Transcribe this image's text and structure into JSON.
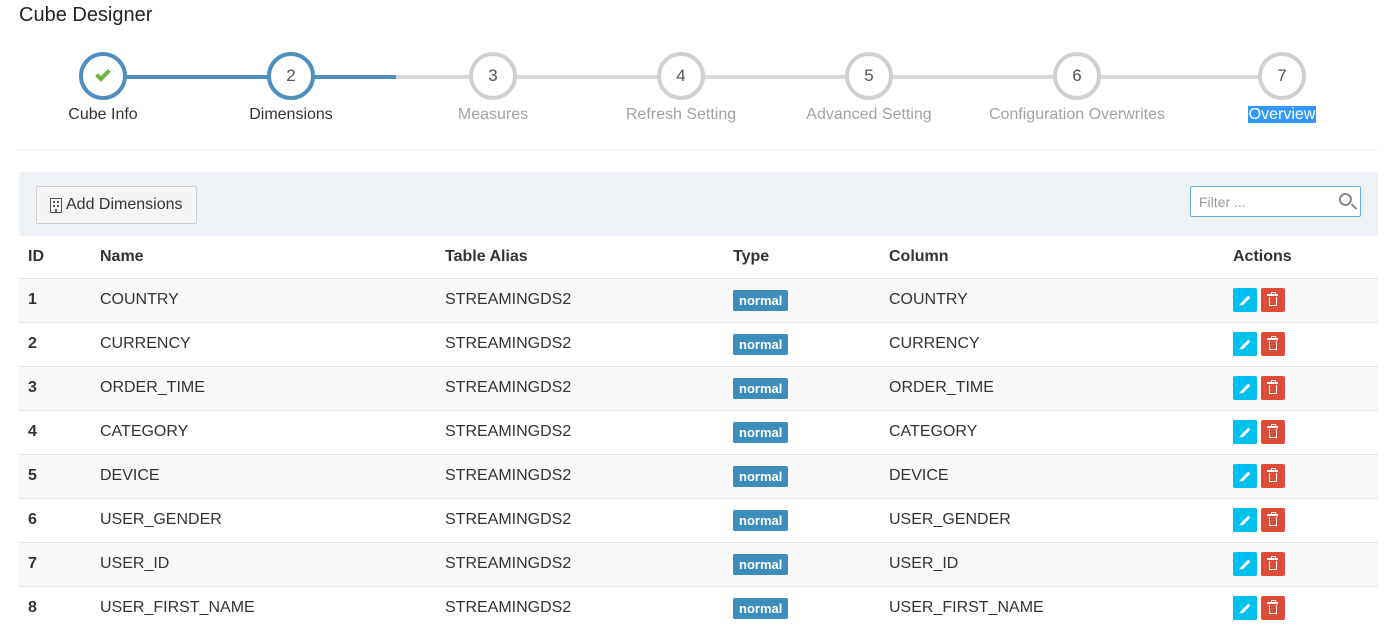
{
  "page": {
    "title": "Cube Designer"
  },
  "wizard": {
    "steps": [
      {
        "number": "1",
        "label": "Cube Info",
        "state": "complete"
      },
      {
        "number": "2",
        "label": "Dimensions",
        "state": "active"
      },
      {
        "number": "3",
        "label": "Measures",
        "state": "pending"
      },
      {
        "number": "4",
        "label": "Refresh Setting",
        "state": "pending"
      },
      {
        "number": "5",
        "label": "Advanced Setting",
        "state": "pending"
      },
      {
        "number": "6",
        "label": "Configuration Overwrites",
        "state": "pending"
      },
      {
        "number": "7",
        "label": "Overview",
        "state": "pending"
      }
    ]
  },
  "toolbar": {
    "add_label": "Add Dimensions",
    "filter_placeholder": "Filter ...",
    "filter_value": ""
  },
  "table": {
    "headers": [
      "ID",
      "Name",
      "Table Alias",
      "Type",
      "Column",
      "Actions"
    ],
    "rows": [
      {
        "id": "1",
        "name": "COUNTRY",
        "alias": "STREAMINGDS2",
        "type": "normal",
        "column": "COUNTRY"
      },
      {
        "id": "2",
        "name": "CURRENCY",
        "alias": "STREAMINGDS2",
        "type": "normal",
        "column": "CURRENCY"
      },
      {
        "id": "3",
        "name": "ORDER_TIME",
        "alias": "STREAMINGDS2",
        "type": "normal",
        "column": "ORDER_TIME"
      },
      {
        "id": "4",
        "name": "CATEGORY",
        "alias": "STREAMINGDS2",
        "type": "normal",
        "column": "CATEGORY"
      },
      {
        "id": "5",
        "name": "DEVICE",
        "alias": "STREAMINGDS2",
        "type": "normal",
        "column": "DEVICE"
      },
      {
        "id": "6",
        "name": "USER_GENDER",
        "alias": "STREAMINGDS2",
        "type": "normal",
        "column": "USER_GENDER"
      },
      {
        "id": "7",
        "name": "USER_ID",
        "alias": "STREAMINGDS2",
        "type": "normal",
        "column": "USER_ID"
      },
      {
        "id": "8",
        "name": "USER_FIRST_NAME",
        "alias": "STREAMINGDS2",
        "type": "normal",
        "column": "USER_FIRST_NAME"
      }
    ]
  },
  "colors": {
    "accent": "#4f8fbf",
    "badge": "#3c8dbc",
    "edit": "#00c0ef",
    "delete": "#dd4b39",
    "check": "#72b33e",
    "highlight": "#3399ff"
  }
}
